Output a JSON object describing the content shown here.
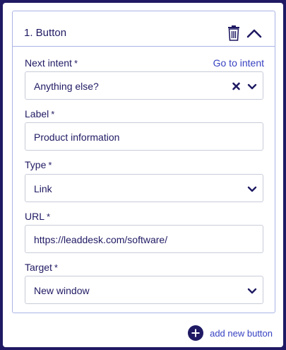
{
  "button_card": {
    "title": "1. Button",
    "trash_icon": "trash-icon",
    "collapse_icon": "chevron-up-icon"
  },
  "fields": {
    "next_intent": {
      "label": "Next intent",
      "required_mark": "*",
      "link": "Go to intent",
      "value": "Anything else?"
    },
    "label": {
      "label": "Label",
      "required_mark": "*",
      "value": "Product information"
    },
    "type": {
      "label": "Type",
      "required_mark": "*",
      "value": "Link"
    },
    "url": {
      "label": "URL",
      "required_mark": "*",
      "value": "https://leaddesk.com/software/"
    },
    "target": {
      "label": "Target",
      "required_mark": "*",
      "value": "New window"
    }
  },
  "footer": {
    "add_button_label": "add new button",
    "add_icon": "plus-circle-icon"
  },
  "colors": {
    "frame": "#1f1a63",
    "text": "#1f1a63",
    "link": "#3742c2",
    "border": "#aab4e6"
  }
}
